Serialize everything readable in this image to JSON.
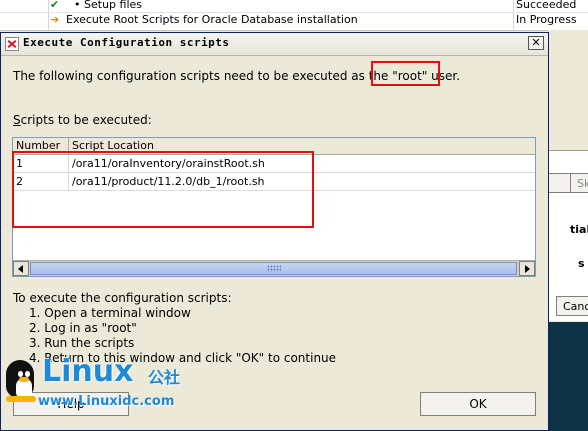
{
  "background": {
    "rows": [
      {
        "name": "Setup files",
        "bullet": "•",
        "status": "Succeeded",
        "icon": "check-icon"
      },
      {
        "name": "Execute Root Scripts for Oracle Database installation",
        "status": "In Progress",
        "icon": "arrow-right-icon"
      }
    ],
    "right_texts": [
      "tial,",
      "s"
    ],
    "partial_button_1": "Sk",
    "partial_button_2": "Cance"
  },
  "dialog": {
    "title": "Execute Configuration scripts",
    "close_glyph": "✕",
    "intro_before": "The following configuration scripts need to be executed as the ",
    "intro_highlight": "\"root\" user.",
    "scripts_label_underlined": "S",
    "scripts_label_rest": "cripts to be executed:",
    "table": {
      "columns": [
        "Number",
        "Script Location"
      ],
      "rows": [
        {
          "number": "1",
          "location": "/ora11/oraInventory/orainstRoot.sh"
        },
        {
          "number": "2",
          "location": "/ora11/product/11.2.0/db_1/root.sh"
        }
      ]
    },
    "exec_title": "To execute the configuration scripts:",
    "steps": [
      "1. Open a terminal window",
      "2. Log in as \"root\"",
      "3. Run the scripts",
      "4. Return to this window and click \"OK\" to continue"
    ],
    "help_label": "Help",
    "ok_label": "OK"
  },
  "watermark": {
    "logo": "Linux",
    "cn": "公社",
    "url": "www.Linuxidc.com"
  },
  "colors": {
    "highlight_red": "#e01010",
    "watermark_blue": "#1e8ad6",
    "dialog_bg": "#ece9d8"
  }
}
